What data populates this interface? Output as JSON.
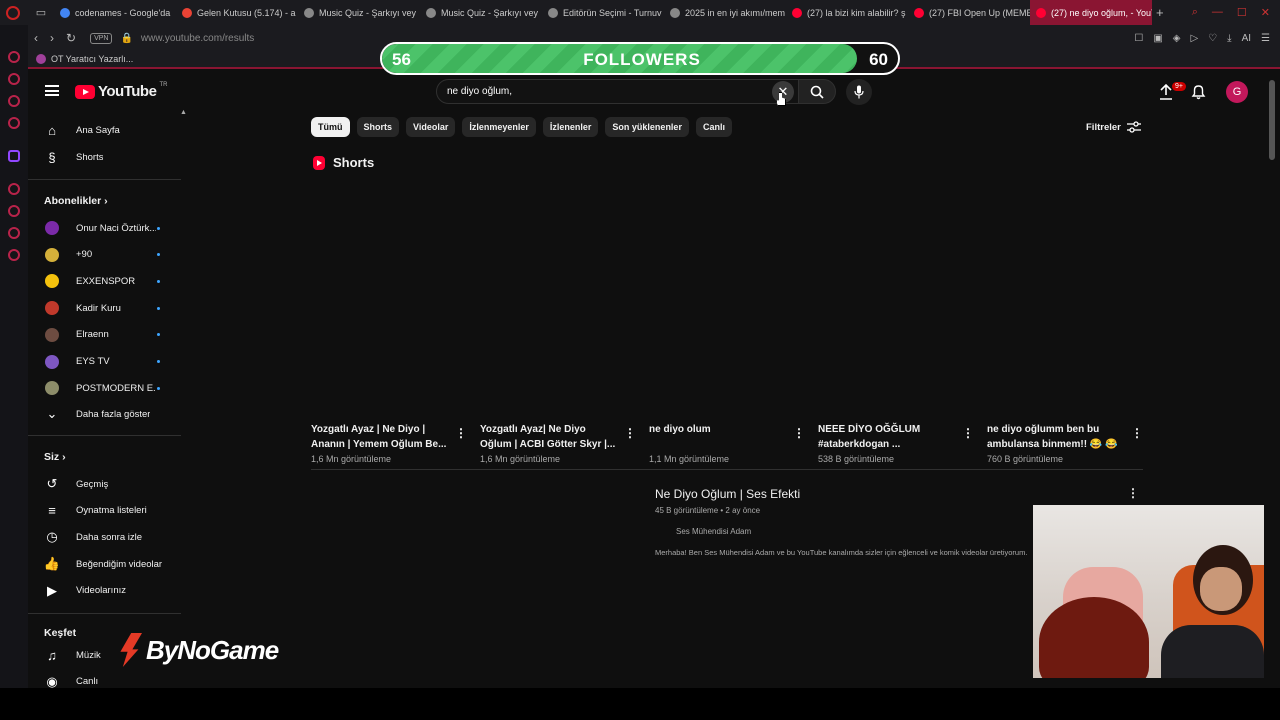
{
  "browser": {
    "tabs": [
      {
        "label": "codenames - Google'da",
        "color": "#4285f4"
      },
      {
        "label": "Gelen Kutusu (5.174) - a",
        "color": "#ea4335"
      },
      {
        "label": "Music Quiz - Şarkıyı vey",
        "color": "#888888"
      },
      {
        "label": "Music Quiz - Şarkıyı vey",
        "color": "#888888"
      },
      {
        "label": "Editörün Seçimi - Turnuv",
        "color": "#888888"
      },
      {
        "label": "2025 in en iyi akımı/mem",
        "color": "#888888"
      },
      {
        "label": "(27) la bizi kim alabilir? ş",
        "color": "#ff0033"
      },
      {
        "label": "(27) FBI Open Up (MEME",
        "color": "#ff0033"
      },
      {
        "label": "(27) ne diyo oğlum, - YouT",
        "color": "#ff0033",
        "active": true
      }
    ],
    "vpn": "VPN",
    "url": "www.youtube.com/results",
    "bookmark": "OT Yaratıcı Yazarlı..."
  },
  "overlay": {
    "current": "56",
    "label": "FOLLOWERS",
    "goal": "60",
    "progress": 0.92,
    "brand": "ByNoGame"
  },
  "header": {
    "logo": "YouTube",
    "country": "TR",
    "search_value": "ne diyo oğlum,",
    "notification_badge": "9+",
    "avatar_letter": "G"
  },
  "guide": {
    "main": [
      {
        "label": "Ana Sayfa",
        "icon": "home-icon"
      },
      {
        "label": "Shorts",
        "icon": "shorts-icon"
      }
    ],
    "subscriptions_title": "Abonelikler",
    "subscriptions": [
      {
        "label": "Onur Naci Öztürk...",
        "color": "#7b2aa8"
      },
      {
        "label": "+90",
        "color": "#d4b03a"
      },
      {
        "label": "EXXENSPOR",
        "color": "#f4c20d"
      },
      {
        "label": "Kadir Kuru",
        "color": "#c0392b"
      },
      {
        "label": "Elraenn",
        "color": "#6d4c41"
      },
      {
        "label": "EYS TV",
        "color": "#7e57c2"
      },
      {
        "label": "POSTMODERN E...",
        "color": "#8d8d6a"
      }
    ],
    "show_more": "Daha fazla göster",
    "you_title": "Siz",
    "you": [
      {
        "label": "Geçmiş",
        "icon": "history-icon"
      },
      {
        "label": "Oynatma listeleri",
        "icon": "playlists-icon"
      },
      {
        "label": "Daha sonra izle",
        "icon": "watch-later-icon"
      },
      {
        "label": "Beğendiğim videolar",
        "icon": "liked-icon"
      },
      {
        "label": "Videolarınız",
        "icon": "your-videos-icon"
      }
    ],
    "explore_title": "Keşfet",
    "explore": [
      {
        "label": "Müzik",
        "icon": "music-icon"
      },
      {
        "label": "Canlı",
        "icon": "live-icon"
      }
    ]
  },
  "chips": [
    "Tümü",
    "Shorts",
    "Videolar",
    "İzlenmeyenler",
    "İzlenenler",
    "Son yüklenenler",
    "Canlı"
  ],
  "filters_label": "Filtreler",
  "shorts_section": {
    "title": "Shorts",
    "items": [
      {
        "title": "Yozgatlı Ayaz | Ne Diyo | Ananın | Yemem Oğlum Be...",
        "views": "1,6 Mn görüntüleme"
      },
      {
        "title": "Yozgatlı Ayaz| Ne Diyo Oğlum | ACBI Götter Skyr |...",
        "views": "1,6 Mn görüntüleme"
      },
      {
        "title": "ne diyo olum",
        "views": "1,1 Mn görüntüleme"
      },
      {
        "title": "NEEE DİYO OĞĞLUM #ataberkdogan ...",
        "views": "538 B görüntüleme"
      },
      {
        "title": "ne diyo oğlumm ben bu ambulansa binmem!! 😂 😂",
        "views": "760 B görüntüleme"
      }
    ]
  },
  "video": {
    "title": "Ne Diyo Oğlum | Ses Efekti",
    "meta": "45 B görüntüleme • 2 ay önce",
    "channel": "Ses Mühendisi Adam",
    "description": "Merhaba! Ben Ses Mühendisi Adam ve bu YouTube kanalımda sizler için eğlenceli ve komik videolar üretiyorum."
  }
}
